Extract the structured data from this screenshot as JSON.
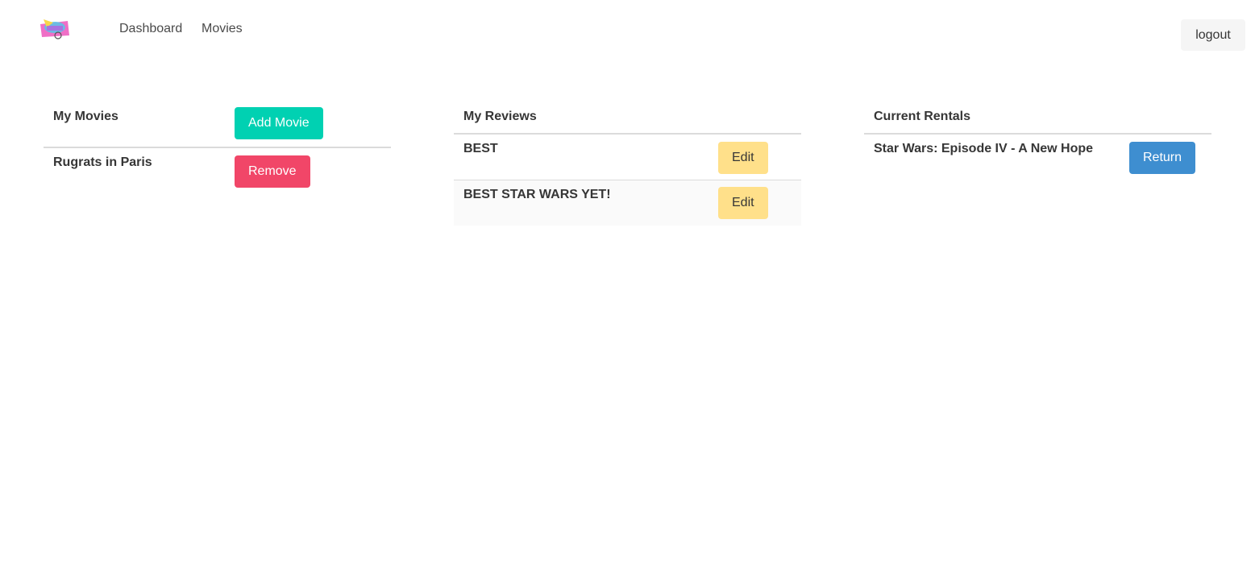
{
  "nav": {
    "links": [
      "Dashboard",
      "Movies"
    ],
    "logout_label": "logout"
  },
  "movies": {
    "header": "My Movies",
    "add_label": "Add Movie",
    "items": [
      {
        "title": "Rugrats in Paris",
        "action": "Remove"
      }
    ]
  },
  "reviews": {
    "header": "My Reviews",
    "items": [
      {
        "title": "BEST",
        "action": "Edit"
      },
      {
        "title": "BEST STAR WARS YET!",
        "action": "Edit"
      }
    ]
  },
  "rentals": {
    "header": "Current Rentals",
    "items": [
      {
        "title": "Star Wars: Episode IV - A New Hope",
        "action": "Return"
      }
    ]
  },
  "colors": {
    "primary": "#00d1b2",
    "danger": "#f14668",
    "warning": "#ffe08a",
    "info": "#3e8ed0"
  }
}
